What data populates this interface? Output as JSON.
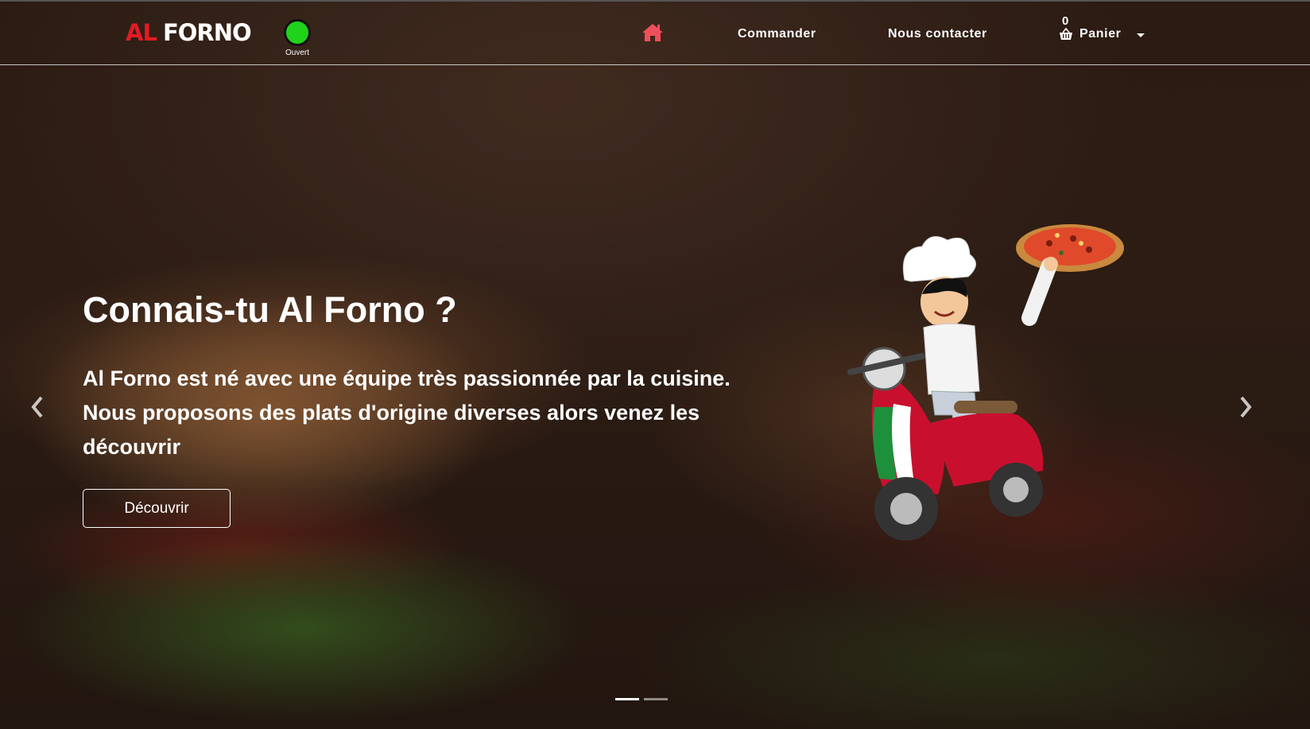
{
  "brand": {
    "part1": "AL",
    "part2": "FORNO",
    "accent_color": "#e21b24"
  },
  "status": {
    "label": "Ouvert",
    "color": "#1fd31a"
  },
  "nav": {
    "home_icon": "home-icon",
    "home_color": "#ef4f5b",
    "commander": "Commander",
    "contact": "Nous contacter",
    "cart": {
      "count": "0",
      "label": "Panier",
      "icon": "basket-icon"
    }
  },
  "hero": {
    "title": "Connais-tu Al Forno ?",
    "text": "Al Forno est né avec une équipe très passionnée par la cuisine. Nous proposons des plats d'origine diverses alors venez les découvrir",
    "cta": "Découvrir",
    "slides": 2,
    "active_slide": 1
  }
}
